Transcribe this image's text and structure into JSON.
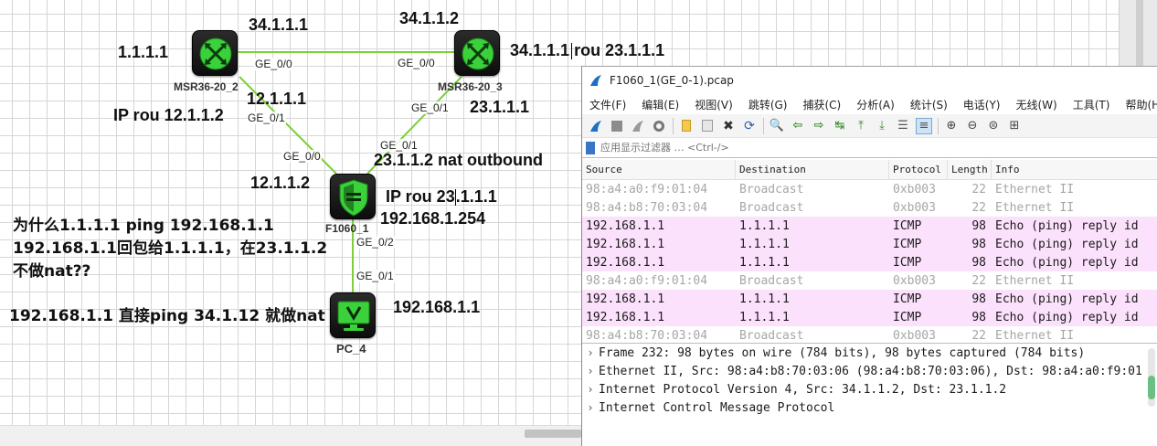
{
  "topology": {
    "devices": [
      {
        "id": "msr1",
        "name": "MSR36-20_2",
        "icon": "router-icon"
      },
      {
        "id": "msr2",
        "name": "MSR36-20_3",
        "icon": "router-icon"
      },
      {
        "id": "fw",
        "name": "F1060_1",
        "icon": "firewall-shield-icon"
      },
      {
        "id": "pc",
        "name": "PC_4",
        "icon": "pc-monitor-icon"
      }
    ],
    "ports": {
      "msr1_g00": "GE_0/0",
      "msr2_g00": "GE_0/0",
      "msr1_g01": "GE_0/1",
      "msr2_g01": "GE_0/1",
      "fw_g00": "GE_0/0",
      "fw_g01": "GE_0/1",
      "fw_g02": "GE_0/2",
      "pc_g01": "GE_0/1"
    },
    "labels": {
      "ip_34_1_1_1": "34.1.1.1",
      "ip_34_1_1_2": "34.1.1.2",
      "ip_1_1_1_1": "1.1.1.1",
      "route_msr2_a": "34.1.1.1",
      "route_msr2_b": "rou 23.1.1.1",
      "ip_12_1_1_1": "12.1.1.1",
      "route_msr1": "IP rou 12.1.1.2",
      "ip_23_1_1_1": "23.1.1.1",
      "nat_note": "23.1.1.2 nat outbound",
      "ip_12_1_1_2": "12.1.1.2",
      "fw_route_a": "IP rou 23",
      "fw_route_b": ".1.1.1",
      "ip_192_168_1_254": "192.168.1.254",
      "ip_192_168_1_1": "192.168.1.1"
    },
    "notes": {
      "q_line1": "为什么1.1.1.1 ping 192.168.1.1",
      "q_line2": "192.168.1.1回包给1.1.1.1，在23.1.1.2",
      "q_line3": "不做nat??",
      "q_line4": "192.168.1.1 直接ping 34.1.12 就做nat"
    },
    "colors": {
      "link": "#7ccf3a",
      "device_green": "#3ad13a"
    }
  },
  "wireshark": {
    "title": "F1060_1(GE_0-1).pcap",
    "menu": [
      "文件(F)",
      "编辑(E)",
      "视图(V)",
      "跳转(G)",
      "捕获(C)",
      "分析(A)",
      "统计(S)",
      "电话(Y)",
      "无线(W)",
      "工具(T)",
      "帮助(H)"
    ],
    "filter_placeholder": "应用显示过滤器 … <Ctrl-/>",
    "columns": [
      "Source",
      "Destination",
      "Protocol",
      "Length",
      "Info"
    ],
    "packets": [
      {
        "src": "98:a4:a0:f9:01:04",
        "dst": "Broadcast",
        "proto": "0xb003",
        "len": "22",
        "info": "Ethernet II",
        "kind": "eth"
      },
      {
        "src": "98:a4:b8:70:03:04",
        "dst": "Broadcast",
        "proto": "0xb003",
        "len": "22",
        "info": "Ethernet II",
        "kind": "eth"
      },
      {
        "src": "192.168.1.1",
        "dst": "1.1.1.1",
        "proto": "ICMP",
        "len": "98",
        "info": "Echo (ping) reply    id",
        "kind": "icmp"
      },
      {
        "src": "192.168.1.1",
        "dst": "1.1.1.1",
        "proto": "ICMP",
        "len": "98",
        "info": "Echo (ping) reply    id",
        "kind": "icmp"
      },
      {
        "src": "192.168.1.1",
        "dst": "1.1.1.1",
        "proto": "ICMP",
        "len": "98",
        "info": "Echo (ping) reply    id",
        "kind": "icmp"
      },
      {
        "src": "98:a4:a0:f9:01:04",
        "dst": "Broadcast",
        "proto": "0xb003",
        "len": "22",
        "info": "Ethernet II",
        "kind": "eth"
      },
      {
        "src": "192.168.1.1",
        "dst": "1.1.1.1",
        "proto": "ICMP",
        "len": "98",
        "info": "Echo (ping) reply    id",
        "kind": "icmp"
      },
      {
        "src": "192.168.1.1",
        "dst": "1.1.1.1",
        "proto": "ICMP",
        "len": "98",
        "info": "Echo (ping) reply    id",
        "kind": "icmp"
      },
      {
        "src": "98:a4:b8:70:03:04",
        "dst": "Broadcast",
        "proto": "0xb003",
        "len": "22",
        "info": "Ethernet II",
        "kind": "eth"
      }
    ],
    "details": [
      "Frame 232: 98 bytes on wire (784 bits), 98 bytes captured (784 bits)",
      "Ethernet II, Src: 98:a4:b8:70:03:06 (98:a4:b8:70:03:06), Dst: 98:a4:a0:f9:01",
      "Internet Protocol Version 4, Src: 34.1.1.2, Dst: 23.1.1.2",
      "Internet Control Message Protocol"
    ],
    "colors": {
      "icmp_row": "#fbe1fb",
      "eth_text": "#a6a6a6"
    }
  }
}
